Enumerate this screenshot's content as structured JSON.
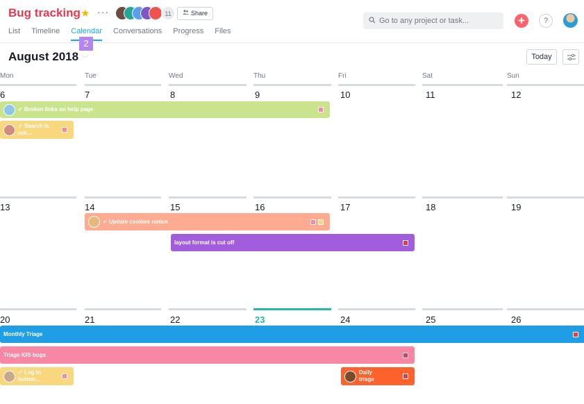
{
  "header": {
    "project_title": "Bug tracking",
    "star_icon": "star-icon",
    "more_icon": "ellipsis-icon",
    "member_count": "11",
    "share_label": "Share",
    "tabs": [
      {
        "label": "List"
      },
      {
        "label": "Timeline"
      },
      {
        "label": "Calendar",
        "active": true
      },
      {
        "label": "Conversations"
      },
      {
        "label": "Progress"
      },
      {
        "label": "Files"
      }
    ],
    "step_badge": "2",
    "search_placeholder": "Go to any project or task...",
    "add_icon": "+",
    "help_icon": "?"
  },
  "calendar": {
    "month_label": "August 2018",
    "today_label": "Today",
    "weekdays": [
      "Mon",
      "Tue",
      "Wed",
      "Thu",
      "Fri",
      "Sat",
      "Sun"
    ],
    "weeks": [
      {
        "days": [
          "6",
          "7",
          "8",
          "9",
          "10",
          "11",
          "12"
        ]
      },
      {
        "days": [
          "13",
          "14",
          "15",
          "16",
          "17",
          "18",
          "19"
        ]
      },
      {
        "days": [
          "20",
          "21",
          "22",
          "23",
          "24",
          "25",
          "26"
        ]
      }
    ],
    "today": "23",
    "tasks": [
      {
        "label": "✔ Broken links on help page",
        "color": "#c9e48c"
      },
      {
        "label": "✔ Search is not…",
        "color": "#f9d77e"
      },
      {
        "label": "✔ Update cookies notice",
        "color": "#ffab91"
      },
      {
        "label": "layout format is cut off",
        "color": "#a25ddc"
      },
      {
        "label": "Monthly Triage",
        "color": "#1f9de5"
      },
      {
        "label": "Triage IOS bugs",
        "color": "#f887a5"
      },
      {
        "label": "✔ Log in button…",
        "color": "#f9d77e"
      },
      {
        "label": "Daily triage",
        "color": "#fd612c"
      }
    ]
  },
  "colors": {
    "brand": "#e8384f",
    "accent": "#14aaf5",
    "today": "#25b7a8",
    "tag_pink": "#f887a5",
    "tag_yellow": "#f9d77e",
    "tag_red": "#e8384f"
  }
}
